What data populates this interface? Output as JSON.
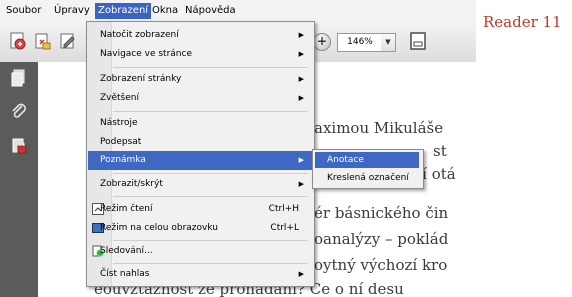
{
  "menubar": {
    "items": [
      "Soubor",
      "Úpravy",
      "Zobrazení",
      "Okna",
      "Nápověda"
    ],
    "active_index": 2
  },
  "toolbar": {
    "zoom_value": "146%",
    "zoom_in_symbol": "+",
    "zoom_out_symbol": "–",
    "dropdown_symbol": "▼"
  },
  "side_label": "Reader 11",
  "menu": {
    "items": [
      {
        "label": "Natočit zobrazení",
        "submenu": true
      },
      {
        "label": "Navigace ve stránce",
        "submenu": true
      },
      {
        "label": "Zobrazení stránky",
        "submenu": true
      },
      {
        "label": "Zvětšení",
        "submenu": true
      },
      {
        "label": "Nástroje",
        "submenu": false
      },
      {
        "label": "Podepsat",
        "submenu": false
      },
      {
        "label": "Poznámka",
        "submenu": true,
        "highlighted": true
      },
      {
        "label": "Zobrazit/skrýt",
        "submenu": true
      },
      {
        "label": "Režim čtení",
        "shortcut": "Ctrl+H",
        "icon": "reading-mode-icon"
      },
      {
        "label": "Režim na celou obrazovku",
        "shortcut": "Ctrl+L",
        "icon": "fullscreen-icon"
      },
      {
        "label": "Sledování...",
        "icon": "tracking-icon"
      },
      {
        "label": "Číst nahlas",
        "submenu": true
      }
    ],
    "submenu_arrow": "▶"
  },
  "submenu": {
    "items": [
      {
        "label": "Anotace",
        "highlighted": true
      },
      {
        "label": "Kreslená označení"
      }
    ]
  },
  "document": {
    "lines": [
      "aximou Mikuláše",
      "st",
      "a „zodpovídání otá",
      "ér básnického čin",
      "oanalýzy – poklád",
      "oytný výchozí kro",
      "eouvztažnost ze prohádání? Ce o ní desu"
    ]
  },
  "icons": {
    "toolbar": [
      "create-pdf-icon",
      "open-icon",
      "edit-icon"
    ],
    "leftpane": [
      "pages-icon",
      "attachments-icon",
      "security-icon"
    ]
  },
  "colors": {
    "menu_highlight": "#3f68c3",
    "menubar_active": "#3a64c4",
    "left_pane": "#5b5b5b",
    "reader_label": "#c0392b"
  }
}
